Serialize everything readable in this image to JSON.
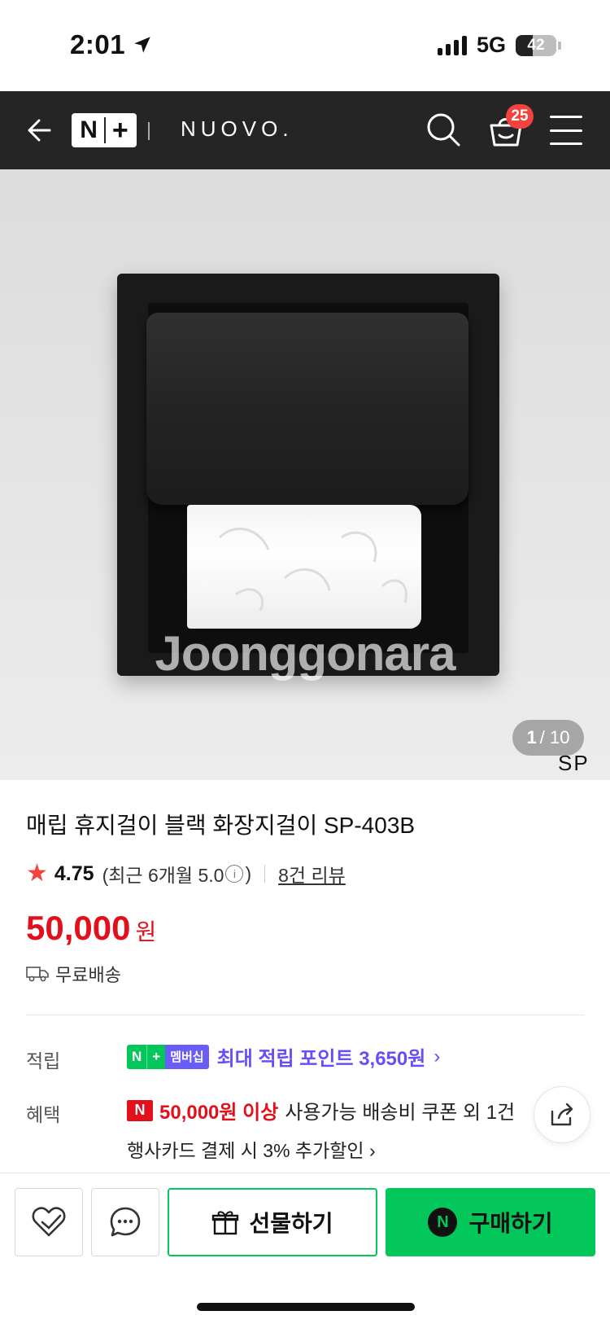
{
  "status_bar": {
    "time": "2:01",
    "network": "5G",
    "battery": "42",
    "battery_level": 0.42
  },
  "header": {
    "brand_badge": "N+",
    "store_name": "NUOVO.",
    "cart_count": "25",
    "icons": [
      "back-arrow-icon",
      "search-icon",
      "cart-icon",
      "menu-icon"
    ]
  },
  "product_image": {
    "watermark": "Joonggonara",
    "page_current": "1",
    "page_total": "/ 10",
    "brand_mark": "SP"
  },
  "product": {
    "title": "매립 휴지걸이 블랙 화장지걸이 SP-403B",
    "rating": "4.75",
    "recent_rating_prefix": "(최근 6개월 5.0",
    "recent_rating_suffix": ")",
    "review_count": "8건 리뷰",
    "price": "50,000",
    "currency": "원",
    "delivery": "무료배송"
  },
  "points": {
    "label": "적립",
    "badge_n": "N",
    "badge_plus": "+",
    "badge_membership": "멤버십",
    "text": "최대 적립 포인트 3,650원"
  },
  "benefit": {
    "label": "혜택",
    "badge": "N",
    "highlight": "50,000원 이상",
    "rest": "사용가능 배송비 쿠폰 외 1건",
    "line2": "행사카드 결제 시 3% 추가할인"
  },
  "bottom_bar": {
    "gift_label": "선물하기",
    "buy_label": "구매하기",
    "buy_badge": "N"
  },
  "colors": {
    "header_bg": "#252525",
    "price_red": "#e2101b",
    "naver_green": "#03c75a",
    "points_purple": "#6a4df5",
    "cart_badge": "#f4433e"
  }
}
